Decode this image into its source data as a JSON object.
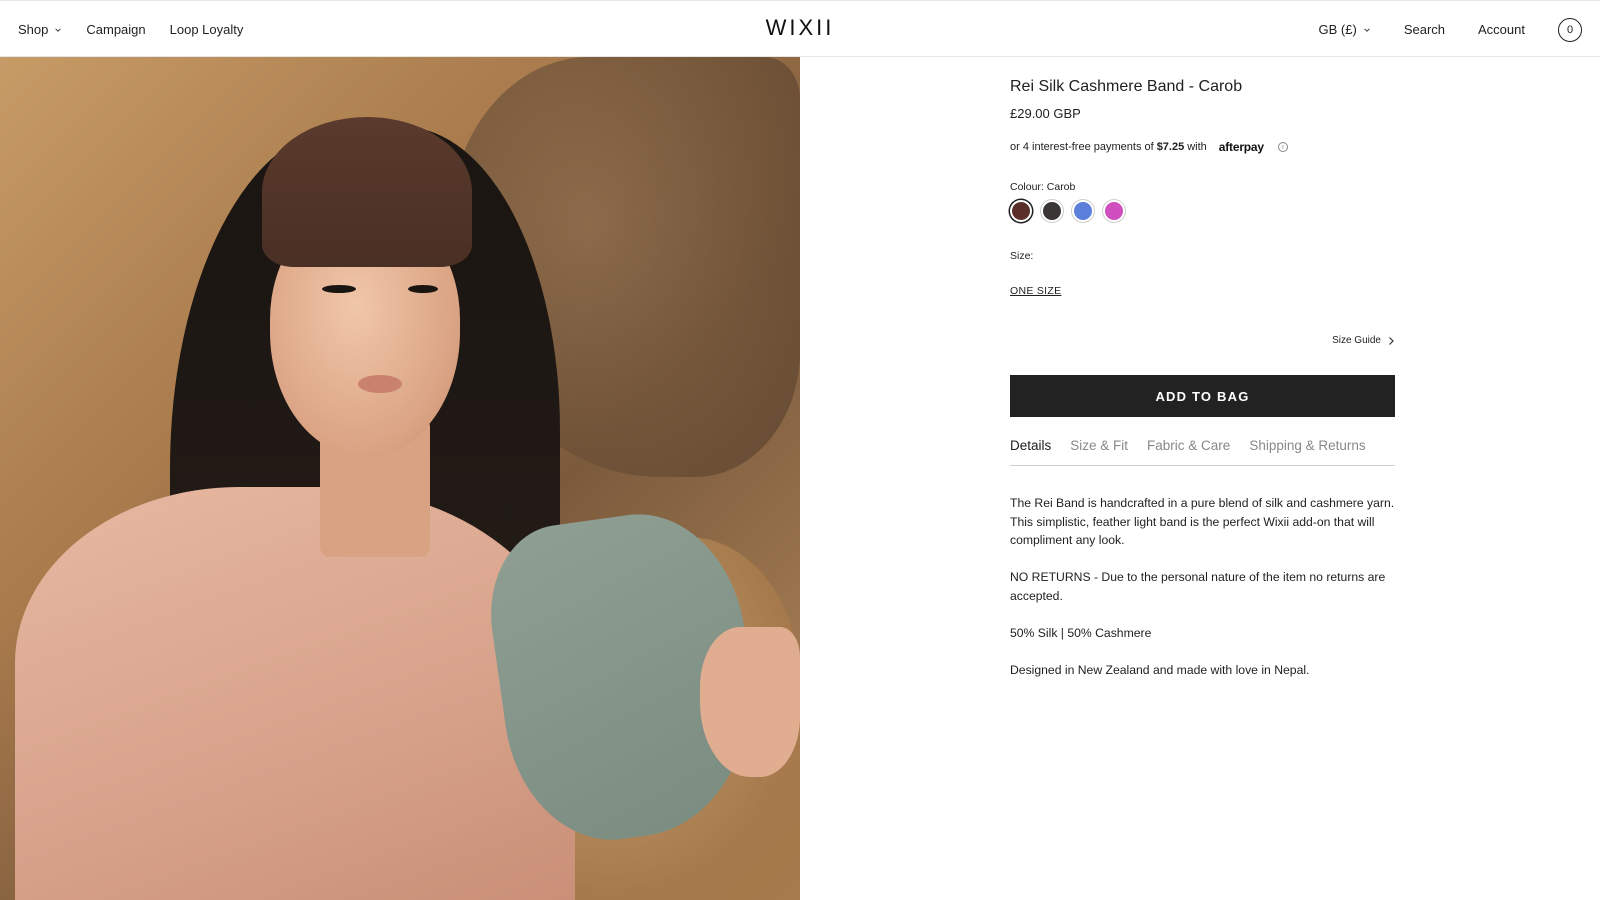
{
  "header": {
    "nav_left": [
      {
        "label": "Shop",
        "has_dropdown": true
      },
      {
        "label": "Campaign"
      },
      {
        "label": "Loop Loyalty"
      }
    ],
    "logo": "WIXII",
    "region": "GB (£)",
    "search": "Search",
    "account": "Account",
    "cart_count": "0"
  },
  "hero": {
    "subject": "model wearing brown headband, pink top with sage sleeves, seated on sandstone rocks"
  },
  "product": {
    "title": "Rei Silk Cashmere Band - Carob",
    "price": "£29.00 GBP",
    "afterpay": {
      "prefix": "or 4 interest-free payments of",
      "amount": "$7.25",
      "suffix": "with",
      "brand": "afterpay",
      "info_icon": "ⓘ"
    },
    "colour_label": "Colour: Carob",
    "swatches": [
      {
        "name": "Carob",
        "color": "#5a2f28",
        "selected": true
      },
      {
        "name": "Charcoal",
        "color": "#3b3636",
        "selected": false
      },
      {
        "name": "Blue",
        "color": "#5d7fdc",
        "selected": false
      },
      {
        "name": "Magenta",
        "color": "#d04fbf",
        "selected": false
      }
    ],
    "size_label": "Size:",
    "size_option": "ONE SIZE",
    "size_guide": "Size Guide",
    "add_to_bag": "ADD TO BAG",
    "tabs": [
      {
        "label": "Details",
        "active": true
      },
      {
        "label": "Size & Fit",
        "active": false
      },
      {
        "label": "Fabric & Care",
        "active": false
      },
      {
        "label": "Shipping & Returns",
        "active": false
      }
    ],
    "details": [
      "The Rei Band is handcrafted in a pure blend of silk and cashmere yarn. This simplistic, feather light band is the perfect Wixii add-on that will compliment any look.",
      "NO RETURNS - Due to the personal nature of the item no returns are accepted.",
      "50% Silk | 50% Cashmere",
      "Designed in New Zealand and made with love in Nepal."
    ]
  }
}
